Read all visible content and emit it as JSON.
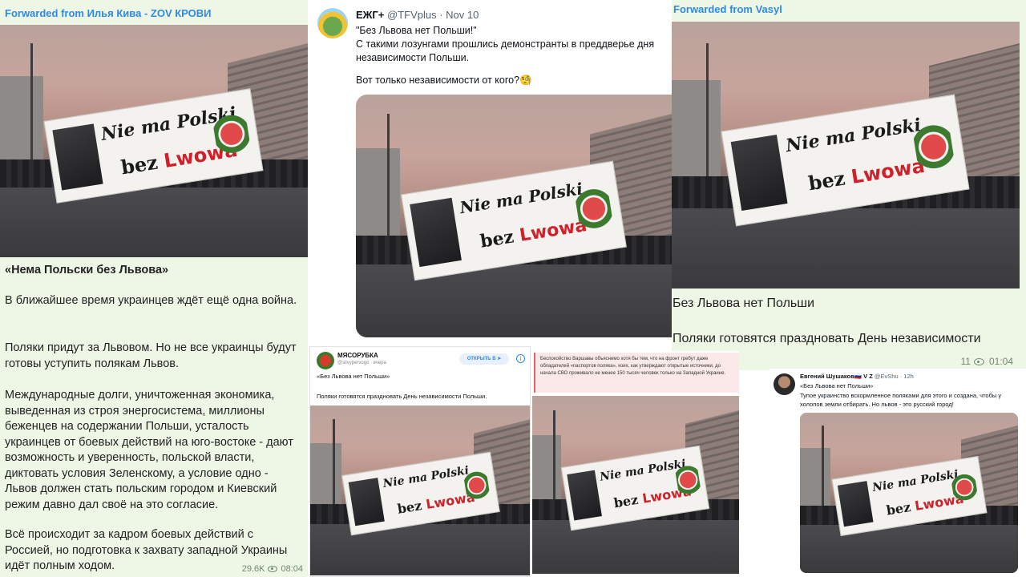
{
  "banner": {
    "line1": "Nie ma Polski",
    "line2_prefix": "bez",
    "line2_city": "Lwowa"
  },
  "panel1": {
    "forwarded": "Forwarded from Илья Кива - ZOV КРОВИ",
    "title": "«Нема Польски без Львова»",
    "paragraph1": "В ближайшее время украинцев ждёт ещё одна война.",
    "paragraph2": "Поляки придут за Львовом. Но не все украинцы будут готовы уступить полякам Львов.",
    "paragraph3": "Международные долги, уничтоженная экономика, выведенная из строя энергосистема, миллионы беженцев на содержании Польши, усталость украинцев от боевых действий на юго-востоке - дают возможность и уверенность, польской власти, диктовать условия Зеленскому, а условие одно - Львов должен стать польским городом и Киевский режим давно дал своё на это согласие.",
    "paragraph4": "Всё происходит за кадром боевых действий с Россией, но подготовка к захвату западной Украины идёт полным ходом.",
    "views": "29.6K",
    "time": "08:04"
  },
  "panel2": {
    "name": "ЕЖГ+",
    "handle": "@TFVplus · Nov 10",
    "line1": "\"Без Львова нет Польши!\"",
    "line2": "С такими лозунгами прошлись демонстранты в преддверье дня независимости Польши.",
    "line3": "Вот только независимости от кого?🧐"
  },
  "panel3": {
    "forwarded": "Forwarded from Vasyl",
    "line1": "Без Львова нет Польши",
    "line2": "Поляки готовятся праздновать День независимости",
    "views": "11",
    "time": "01:04"
  },
  "panel4": {
    "name": "МЯСОРУБКА",
    "handle": "@slivypervogo · вчера",
    "open_button": "ОТКРЫТЬ В",
    "line1": "«Без Львова нет Польши»",
    "line2": "Поляки готовятся праздновать День независимости Польши."
  },
  "panel5": {
    "note": "Беспокойство Варшавы объяснимо хотя бы тем, что на фронт гребут даже обладателей «паспортов поляка», коих, как утверждают открытые источники, до начала СВО проживало не менее 150 тысяч человек только на Западной Украине."
  },
  "panel6": {
    "name": "Евгений Шушаков🇷🇺 V Z",
    "handle": "@EvShu · 12h",
    "line1": "«Без Львова нет Польши»",
    "line2": "Тупое украинство вскормленное поляками для этого и создана, чтобы у",
    "line3": "холопов земли отбирать. Но львов - это русский город!"
  }
}
